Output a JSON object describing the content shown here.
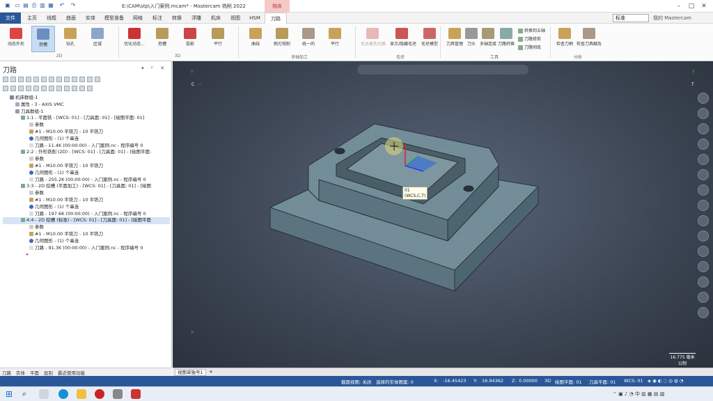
{
  "window": {
    "title": "E:\\CAM\\stp\\入门案例.mcam* - Mastercam 铣削 2022",
    "context_tab": "铣床"
  },
  "menu": {
    "file": "文件",
    "items": [
      "主页",
      "线框",
      "曲面",
      "实体",
      "模型准备",
      "网格",
      "标注",
      "转换",
      "浮雕",
      "机床",
      "视图",
      "HSM",
      "刀路"
    ],
    "layer": "标准",
    "user": "我的 Mastercam"
  },
  "ribbon": {
    "buttons_2d": [
      "动态外形",
      "挖槽",
      "钻孔",
      "区域"
    ],
    "group_2d": "2D",
    "buttons_3d": [
      "优化动态...",
      "挖槽",
      "投影",
      "平行"
    ],
    "group_3d": "3D",
    "buttons_multi": [
      "曲线",
      "侧刃铣削",
      "统一的",
      "平行"
    ],
    "group_multi": "多轴加工",
    "buttons_stock": [
      "毛坯着色切换",
      "显示/隐藏毛坯",
      "毛坯模型"
    ],
    "group_stock": "毛坯",
    "buttons_tools": [
      "刀具管理",
      "刀头",
      "多轴连接",
      "刀路转换"
    ],
    "tools_mini": [
      "转换到五轴",
      "刀路修剪",
      "刀路彻底"
    ],
    "group_tools": "工具",
    "buttons_analysis": [
      "检查刀柄",
      "检查刀具触及"
    ],
    "group_analysis": "分析"
  },
  "panel": {
    "title": "刀路",
    "tree": [
      "机床群组-1",
      "属性 - 3 - AXIS VMC",
      "刀具群组-1",
      "1:1 - 平面铣 - [WCS: 01] - [刀具面: 01] - [绘图平面: 01]",
      "参数",
      "#1 - M10.00 平铣刀 - 10 平铣刀",
      "几何图形 - (1) 个串连",
      "刀路 - 11.4K (00:00:00) - 入门案例.nc - 程序编号 0",
      "2:2 - 外形铣削 (2D) - [WCS: 01] - [刀具面: 01] - [绘图平面:",
      "参数",
      "#1 - M10.00 平铣刀 - 10 平铣刀",
      "几何图形 - (1) 个串连",
      "刀路 - 255.2K (00:00:00) - 入门案例.nc - 程序编号 0",
      "3:3 - 2D 挖槽 (平面加工) - [WCS: 01] - [刀具面: 01] - [绘图",
      "参数",
      "#1 - M10.00 平铣刀 - 10 平铣刀",
      "几何图形 - (1) 个串连",
      "刀路 - 197.6K (00:00:00) - 入门案例.nc - 程序编号 0",
      "4:4 - 2D 挖槽 (标准) - [WCS: 01] - [刀具面: 01] - [绘图平面",
      "参数",
      "#1 - M10.00 平铣刀 - 10 平铣刀",
      "几何图形 - (1) 个串连",
      "刀路 - 91.3K (00:00:00) - 入门案例.nc - 程序编号 0"
    ],
    "tabs": [
      "刀路",
      "实体",
      "平面",
      "层别",
      "最近使用功能"
    ]
  },
  "viewport": {
    "tooltip_line1": "01",
    "tooltip_line2": "(WCS,C,T)",
    "axis_c": "C",
    "axis_t": "T",
    "scale_value": "16.775 毫米",
    "scale_unit": "公制",
    "tab": "视图单独号1"
  },
  "status": {
    "section_view": "截面视图: 关闭",
    "selected": "选择的实体图案: 0",
    "x_label": "X:",
    "x": "-16.45423",
    "y_label": "Y:",
    "y": "16.94362",
    "z_label": "Z:",
    "z": "0.00000",
    "mode": "3D",
    "plane": "绘图平面: 01",
    "tool_plane": "刀具平面: 01",
    "wcs": "WCS: 01"
  },
  "colors": {
    "accent": "#2b579a",
    "viewport": "#3c4553",
    "part": "#6e8a94"
  }
}
